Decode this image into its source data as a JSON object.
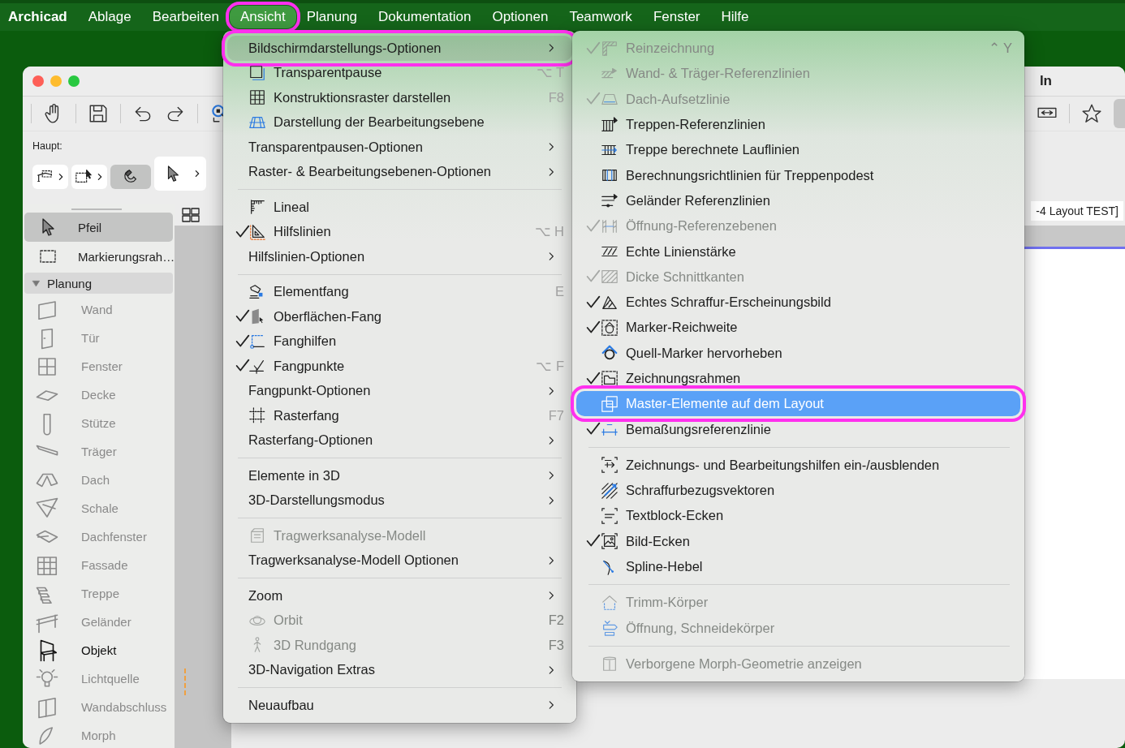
{
  "menubar": [
    {
      "label": "Archicad",
      "kind": "app",
      "selected": false,
      "annotated": false
    },
    {
      "label": "Ablage",
      "kind": "menu",
      "selected": false,
      "annotated": false
    },
    {
      "label": "Bearbeiten",
      "kind": "menu",
      "selected": false,
      "annotated": false
    },
    {
      "label": "Ansicht",
      "kind": "menu",
      "selected": true,
      "annotated": true
    },
    {
      "label": "Planung",
      "kind": "menu",
      "selected": false,
      "annotated": false
    },
    {
      "label": "Dokumentation",
      "kind": "menu",
      "selected": false,
      "annotated": false
    },
    {
      "label": "Optionen",
      "kind": "menu",
      "selected": false,
      "annotated": false
    },
    {
      "label": "Teamwork",
      "kind": "menu",
      "selected": false,
      "annotated": false
    },
    {
      "label": "Fenster",
      "kind": "menu",
      "selected": false,
      "annotated": false
    },
    {
      "label": "Hilfe",
      "kind": "menu",
      "selected": false,
      "annotated": false
    }
  ],
  "window": {
    "title": "ln",
    "toolbar_label": "Haupt:",
    "tab": "-4 Layout TEST]"
  },
  "toolbox": {
    "items": [
      {
        "label": "Pfeil",
        "selected": true
      },
      {
        "label": "Markierungsrah…",
        "selected": false
      }
    ],
    "group": {
      "label": "Planung",
      "expanded": true,
      "children": [
        {
          "label": "Wand",
          "highlighted": false
        },
        {
          "label": "Tür",
          "highlighted": false
        },
        {
          "label": "Fenster",
          "highlighted": false
        },
        {
          "label": "Decke",
          "highlighted": false
        },
        {
          "label": "Stütze",
          "highlighted": false
        },
        {
          "label": "Träger",
          "highlighted": false
        },
        {
          "label": "Dach",
          "highlighted": false
        },
        {
          "label": "Schale",
          "highlighted": false
        },
        {
          "label": "Dachfenster",
          "highlighted": false
        },
        {
          "label": "Fassade",
          "highlighted": false
        },
        {
          "label": "Treppe",
          "highlighted": false
        },
        {
          "label": "Geländer",
          "highlighted": false
        },
        {
          "label": "Objekt",
          "highlighted": true
        },
        {
          "label": "Lichtquelle",
          "highlighted": false
        },
        {
          "label": "Wandabschluss",
          "highlighted": false
        },
        {
          "label": "Morph",
          "highlighted": false
        }
      ]
    }
  },
  "menu": {
    "sections": [
      {
        "items": [
          {
            "label": "Bildschirmdarstellungs-Optionen",
            "kind": "submenu",
            "expanded": true,
            "checked": false,
            "disabled": false,
            "annotated": true
          },
          {
            "label": "Transparentpause",
            "kind": "item",
            "shortcut": "⌥ T",
            "checked": false,
            "disabled": false,
            "annotated": false
          },
          {
            "label": "Konstruktionsraster darstellen",
            "kind": "item",
            "shortcut": "F8",
            "checked": false,
            "disabled": false,
            "annotated": false
          },
          {
            "label": "Darstellung der Bearbeitungsebene",
            "kind": "item",
            "checked": false,
            "disabled": false,
            "annotated": false
          },
          {
            "label": "Transparentpausen-Optionen",
            "kind": "submenu",
            "expanded": false,
            "checked": false,
            "disabled": false,
            "annotated": false
          },
          {
            "label": "Raster- & Bearbeitungsebenen-Optionen",
            "kind": "submenu",
            "expanded": false,
            "checked": false,
            "disabled": false,
            "annotated": false
          }
        ]
      },
      {
        "items": [
          {
            "label": "Lineal",
            "kind": "item",
            "checked": false,
            "disabled": false,
            "annotated": false
          },
          {
            "label": "Hilfslinien",
            "kind": "item",
            "shortcut": "⌥ H",
            "checked": true,
            "disabled": false,
            "annotated": false
          },
          {
            "label": "Hilfslinien-Optionen",
            "kind": "submenu",
            "expanded": false,
            "checked": false,
            "disabled": false,
            "annotated": false
          }
        ]
      },
      {
        "items": [
          {
            "label": "Elementfang",
            "kind": "item",
            "shortcut": "E",
            "checked": false,
            "disabled": false,
            "annotated": false
          },
          {
            "label": "Oberflächen-Fang",
            "kind": "item",
            "checked": true,
            "disabled": false,
            "annotated": false
          },
          {
            "label": "Fanghilfen",
            "kind": "item",
            "checked": true,
            "disabled": false,
            "annotated": false
          },
          {
            "label": "Fangpunkte",
            "kind": "item",
            "shortcut": "⌥ F",
            "checked": true,
            "disabled": false,
            "annotated": false
          },
          {
            "label": "Fangpunkt-Optionen",
            "kind": "submenu",
            "expanded": false,
            "checked": false,
            "disabled": false,
            "annotated": false
          },
          {
            "label": "Rasterfang",
            "kind": "item",
            "shortcut": "F7",
            "checked": false,
            "disabled": false,
            "annotated": false
          },
          {
            "label": "Rasterfang-Optionen",
            "kind": "submenu",
            "expanded": false,
            "checked": false,
            "disabled": false,
            "annotated": false
          }
        ]
      },
      {
        "items": [
          {
            "label": "Elemente in 3D",
            "kind": "submenu",
            "expanded": false,
            "checked": false,
            "disabled": false,
            "annotated": false
          },
          {
            "label": "3D-Darstellungsmodus",
            "kind": "submenu",
            "expanded": false,
            "checked": false,
            "disabled": false,
            "annotated": false
          }
        ]
      },
      {
        "items": [
          {
            "label": "Tragwerksanalyse-Modell",
            "kind": "item",
            "checked": false,
            "disabled": true,
            "annotated": false
          },
          {
            "label": "Tragwerksanalyse-Modell Optionen",
            "kind": "submenu",
            "expanded": false,
            "checked": false,
            "disabled": false,
            "annotated": false
          }
        ]
      },
      {
        "items": [
          {
            "label": "Zoom",
            "kind": "submenu",
            "expanded": false,
            "checked": false,
            "disabled": false,
            "annotated": false
          },
          {
            "label": "Orbit",
            "kind": "item",
            "shortcut": "F2",
            "checked": false,
            "disabled": true,
            "annotated": false
          },
          {
            "label": "3D Rundgang",
            "kind": "item",
            "shortcut": "F3",
            "checked": false,
            "disabled": true,
            "annotated": false
          },
          {
            "label": "3D-Navigation Extras",
            "kind": "submenu",
            "expanded": false,
            "checked": false,
            "disabled": false,
            "annotated": false
          }
        ]
      },
      {
        "items": [
          {
            "label": "Neuaufbau",
            "kind": "submenu",
            "expanded": false,
            "checked": false,
            "disabled": false,
            "annotated": false
          }
        ]
      }
    ]
  },
  "submenu": {
    "sections": [
      {
        "items": [
          {
            "label": "Reinzeichnung",
            "shortcut": "⌃ Y",
            "checked": true,
            "disabled": true,
            "selected": false,
            "annotated": false
          },
          {
            "label": "Wand- & Träger-Referenzlinien",
            "checked": false,
            "disabled": true,
            "selected": false,
            "annotated": false
          },
          {
            "label": "Dach-Aufsetzlinie",
            "checked": true,
            "disabled": true,
            "selected": false,
            "annotated": false
          },
          {
            "label": "Treppen-Referenzlinien",
            "checked": false,
            "disabled": false,
            "selected": false,
            "annotated": false
          },
          {
            "label": "Treppe berechnete Lauflinien",
            "checked": false,
            "disabled": false,
            "selected": false,
            "annotated": false
          },
          {
            "label": "Berechnungsrichtlinien für Treppenpodest",
            "checked": false,
            "disabled": false,
            "selected": false,
            "annotated": false
          },
          {
            "label": "Geländer Referenzlinien",
            "checked": false,
            "disabled": false,
            "selected": false,
            "annotated": false
          },
          {
            "label": "Öffnung-Referenzebenen",
            "checked": true,
            "disabled": true,
            "selected": false,
            "annotated": false
          },
          {
            "label": "Echte Linienstärke",
            "checked": false,
            "disabled": false,
            "selected": false,
            "annotated": false
          },
          {
            "label": "Dicke Schnittkanten",
            "checked": true,
            "disabled": true,
            "selected": false,
            "annotated": false
          },
          {
            "label": "Echtes Schraffur-Erscheinungsbild",
            "checked": true,
            "disabled": false,
            "selected": false,
            "annotated": false
          },
          {
            "label": "Marker-Reichweite",
            "checked": true,
            "disabled": false,
            "selected": false,
            "annotated": false
          },
          {
            "label": "Quell-Marker hervorheben",
            "checked": false,
            "disabled": false,
            "selected": false,
            "annotated": false
          },
          {
            "label": "Zeichnungsrahmen",
            "checked": true,
            "disabled": false,
            "selected": false,
            "annotated": false
          },
          {
            "label": "Master-Elemente auf dem Layout",
            "checked": false,
            "disabled": false,
            "selected": true,
            "annotated": true
          },
          {
            "label": "Bemaßungsreferenzlinie",
            "checked": true,
            "disabled": false,
            "selected": false,
            "annotated": false
          }
        ]
      },
      {
        "items": [
          {
            "label": "Zeichnungs- und Bearbeitungshilfen ein-/ausblenden",
            "checked": false,
            "disabled": false,
            "selected": false,
            "annotated": false
          },
          {
            "label": "Schraffurbezugsvektoren",
            "checked": false,
            "disabled": false,
            "selected": false,
            "annotated": false
          },
          {
            "label": "Textblock-Ecken",
            "checked": false,
            "disabled": false,
            "selected": false,
            "annotated": false
          },
          {
            "label": "Bild-Ecken",
            "checked": true,
            "disabled": false,
            "selected": false,
            "annotated": false
          },
          {
            "label": "Spline-Hebel",
            "checked": false,
            "disabled": false,
            "selected": false,
            "annotated": false
          }
        ]
      },
      {
        "items": [
          {
            "label": "Trimm-Körper",
            "checked": false,
            "disabled": true,
            "selected": false,
            "annotated": false
          },
          {
            "label": "Öffnung, Schneidekörper",
            "checked": false,
            "disabled": true,
            "selected": false,
            "annotated": false
          }
        ]
      },
      {
        "items": [
          {
            "label": "Verborgene Morph-Geometrie anzeigen",
            "checked": false,
            "disabled": true,
            "selected": false,
            "annotated": false
          }
        ]
      }
    ]
  }
}
